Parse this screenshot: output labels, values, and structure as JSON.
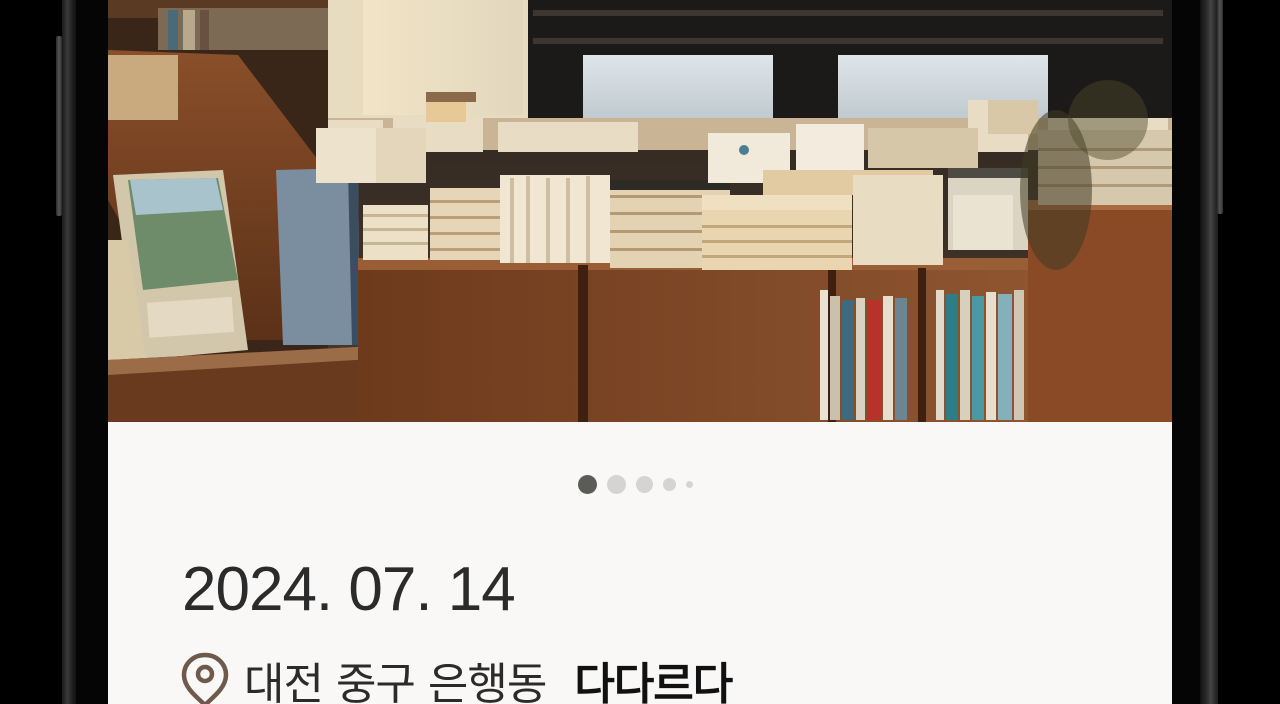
{
  "entry": {
    "date": "2024. 07. 14",
    "location": {
      "address": "대전 중구 은행동",
      "place": "다다르다"
    }
  },
  "photo_carousel": {
    "current_page": 1,
    "total_dots": 5,
    "subject": "bookstore interior photo"
  },
  "icons": {
    "location": "map-pin-icon"
  },
  "colors": {
    "background": "#faf8f6",
    "text_primary": "#2b2b2b",
    "pin_stroke": "#6e5a4d",
    "dot_active": "#5b5b57",
    "dot_inactive": "#d6d4d2"
  }
}
